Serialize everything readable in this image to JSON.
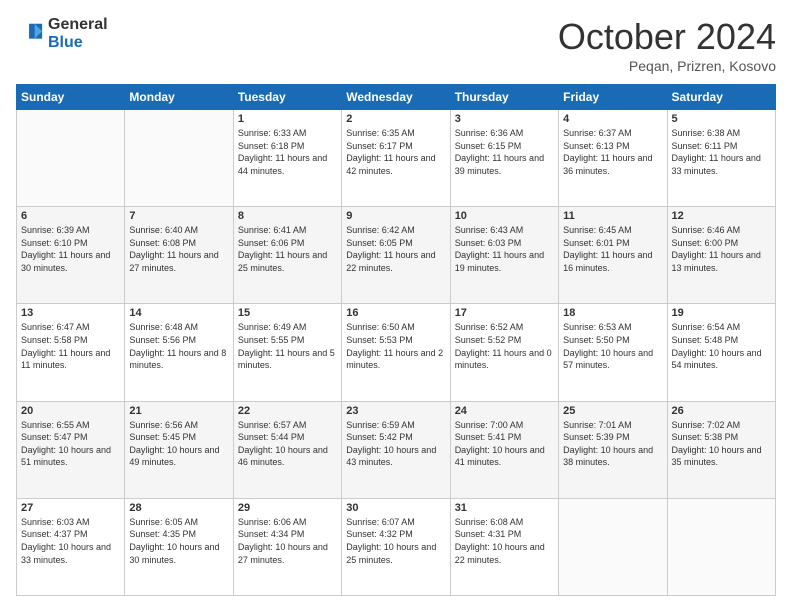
{
  "logo": {
    "general": "General",
    "blue": "Blue"
  },
  "header": {
    "month": "October 2024",
    "location": "Peqan, Prizren, Kosovo"
  },
  "days_of_week": [
    "Sunday",
    "Monday",
    "Tuesday",
    "Wednesday",
    "Thursday",
    "Friday",
    "Saturday"
  ],
  "weeks": [
    [
      {
        "day": "",
        "info": ""
      },
      {
        "day": "",
        "info": ""
      },
      {
        "day": "1",
        "info": "Sunrise: 6:33 AM\nSunset: 6:18 PM\nDaylight: 11 hours and 44 minutes."
      },
      {
        "day": "2",
        "info": "Sunrise: 6:35 AM\nSunset: 6:17 PM\nDaylight: 11 hours and 42 minutes."
      },
      {
        "day": "3",
        "info": "Sunrise: 6:36 AM\nSunset: 6:15 PM\nDaylight: 11 hours and 39 minutes."
      },
      {
        "day": "4",
        "info": "Sunrise: 6:37 AM\nSunset: 6:13 PM\nDaylight: 11 hours and 36 minutes."
      },
      {
        "day": "5",
        "info": "Sunrise: 6:38 AM\nSunset: 6:11 PM\nDaylight: 11 hours and 33 minutes."
      }
    ],
    [
      {
        "day": "6",
        "info": "Sunrise: 6:39 AM\nSunset: 6:10 PM\nDaylight: 11 hours and 30 minutes."
      },
      {
        "day": "7",
        "info": "Sunrise: 6:40 AM\nSunset: 6:08 PM\nDaylight: 11 hours and 27 minutes."
      },
      {
        "day": "8",
        "info": "Sunrise: 6:41 AM\nSunset: 6:06 PM\nDaylight: 11 hours and 25 minutes."
      },
      {
        "day": "9",
        "info": "Sunrise: 6:42 AM\nSunset: 6:05 PM\nDaylight: 11 hours and 22 minutes."
      },
      {
        "day": "10",
        "info": "Sunrise: 6:43 AM\nSunset: 6:03 PM\nDaylight: 11 hours and 19 minutes."
      },
      {
        "day": "11",
        "info": "Sunrise: 6:45 AM\nSunset: 6:01 PM\nDaylight: 11 hours and 16 minutes."
      },
      {
        "day": "12",
        "info": "Sunrise: 6:46 AM\nSunset: 6:00 PM\nDaylight: 11 hours and 13 minutes."
      }
    ],
    [
      {
        "day": "13",
        "info": "Sunrise: 6:47 AM\nSunset: 5:58 PM\nDaylight: 11 hours and 11 minutes."
      },
      {
        "day": "14",
        "info": "Sunrise: 6:48 AM\nSunset: 5:56 PM\nDaylight: 11 hours and 8 minutes."
      },
      {
        "day": "15",
        "info": "Sunrise: 6:49 AM\nSunset: 5:55 PM\nDaylight: 11 hours and 5 minutes."
      },
      {
        "day": "16",
        "info": "Sunrise: 6:50 AM\nSunset: 5:53 PM\nDaylight: 11 hours and 2 minutes."
      },
      {
        "day": "17",
        "info": "Sunrise: 6:52 AM\nSunset: 5:52 PM\nDaylight: 11 hours and 0 minutes."
      },
      {
        "day": "18",
        "info": "Sunrise: 6:53 AM\nSunset: 5:50 PM\nDaylight: 10 hours and 57 minutes."
      },
      {
        "day": "19",
        "info": "Sunrise: 6:54 AM\nSunset: 5:48 PM\nDaylight: 10 hours and 54 minutes."
      }
    ],
    [
      {
        "day": "20",
        "info": "Sunrise: 6:55 AM\nSunset: 5:47 PM\nDaylight: 10 hours and 51 minutes."
      },
      {
        "day": "21",
        "info": "Sunrise: 6:56 AM\nSunset: 5:45 PM\nDaylight: 10 hours and 49 minutes."
      },
      {
        "day": "22",
        "info": "Sunrise: 6:57 AM\nSunset: 5:44 PM\nDaylight: 10 hours and 46 minutes."
      },
      {
        "day": "23",
        "info": "Sunrise: 6:59 AM\nSunset: 5:42 PM\nDaylight: 10 hours and 43 minutes."
      },
      {
        "day": "24",
        "info": "Sunrise: 7:00 AM\nSunset: 5:41 PM\nDaylight: 10 hours and 41 minutes."
      },
      {
        "day": "25",
        "info": "Sunrise: 7:01 AM\nSunset: 5:39 PM\nDaylight: 10 hours and 38 minutes."
      },
      {
        "day": "26",
        "info": "Sunrise: 7:02 AM\nSunset: 5:38 PM\nDaylight: 10 hours and 35 minutes."
      }
    ],
    [
      {
        "day": "27",
        "info": "Sunrise: 6:03 AM\nSunset: 4:37 PM\nDaylight: 10 hours and 33 minutes."
      },
      {
        "day": "28",
        "info": "Sunrise: 6:05 AM\nSunset: 4:35 PM\nDaylight: 10 hours and 30 minutes."
      },
      {
        "day": "29",
        "info": "Sunrise: 6:06 AM\nSunset: 4:34 PM\nDaylight: 10 hours and 27 minutes."
      },
      {
        "day": "30",
        "info": "Sunrise: 6:07 AM\nSunset: 4:32 PM\nDaylight: 10 hours and 25 minutes."
      },
      {
        "day": "31",
        "info": "Sunrise: 6:08 AM\nSunset: 4:31 PM\nDaylight: 10 hours and 22 minutes."
      },
      {
        "day": "",
        "info": ""
      },
      {
        "day": "",
        "info": ""
      }
    ]
  ]
}
